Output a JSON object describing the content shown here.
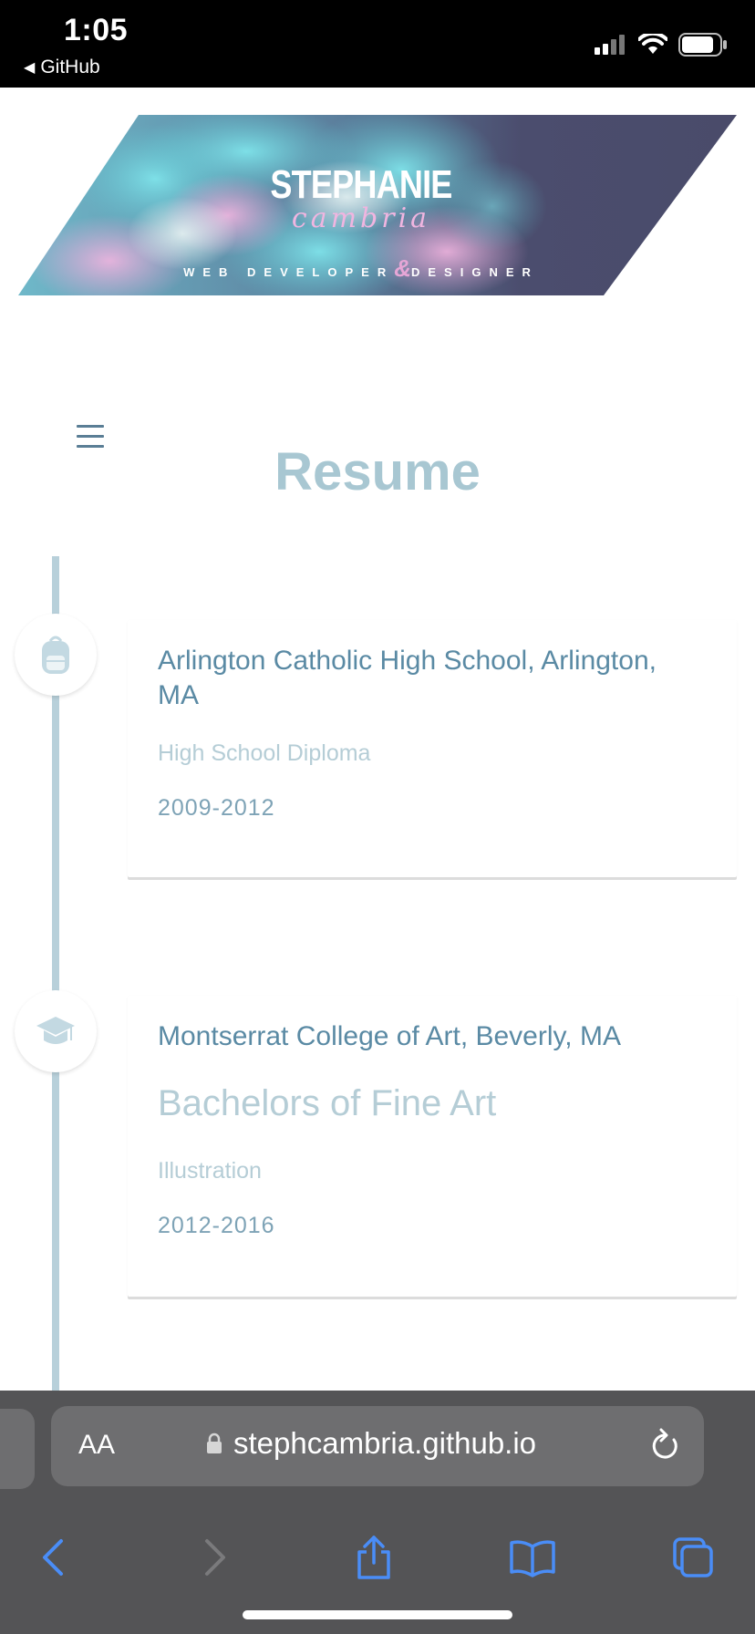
{
  "status_bar": {
    "time": "1:05",
    "back_app": "GitHub"
  },
  "banner": {
    "first_name": "STEPHANIE",
    "last_name": "cambria",
    "role_left": "WEB DEVELOPER",
    "role_amp": "&",
    "role_right": "DESIGNER",
    "colors": {
      "teal": "#5fc4cf",
      "pink": "#e9a7d9",
      "slate": "#4a4b6b"
    }
  },
  "page": {
    "title": "Resume",
    "menu_icon": "hamburger-menu-icon"
  },
  "timeline": [
    {
      "icon": "backpack-icon",
      "school": "Arlington Catholic High School, Arlington, MA",
      "degree": "High School Diploma",
      "years": "2009-2012"
    },
    {
      "icon": "graduation-cap-icon",
      "school": "Montserrat College of Art, Beverly, MA",
      "degree": "Bachelors of Fine Art",
      "field": "Illustration",
      "years": "2012-2016"
    }
  ],
  "browser": {
    "text_size_label": "AA",
    "url": "stephcambria.github.io",
    "accent": "#4a8df7"
  }
}
